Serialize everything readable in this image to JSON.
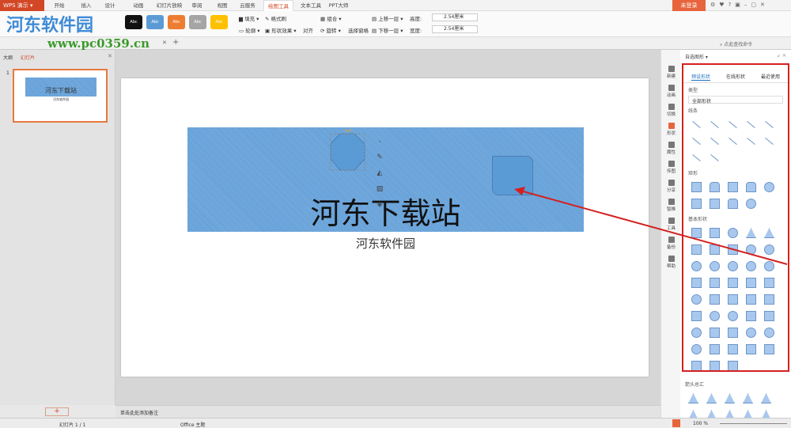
{
  "app": {
    "menu_label": "WPS 演示",
    "login_label": "未登录"
  },
  "tabs": [
    "开始",
    "插入",
    "设计",
    "动画",
    "幻灯片放映",
    "审阅",
    "视图",
    "云服务",
    "绘图工具",
    "文本工具",
    "PPT大师"
  ],
  "active_tab": "绘图工具",
  "ribbon": {
    "style_swatches": [
      {
        "label": "Abc",
        "color": "#111111"
      },
      {
        "label": "Abc",
        "color": "#5b9bd5"
      },
      {
        "label": "Abc",
        "color": "#ed7d31"
      },
      {
        "label": "Abc",
        "color": "#a5a5a5"
      },
      {
        "label": "Abc",
        "color": "#ffc000"
      }
    ],
    "fill": "填充",
    "format_painter": "格式刷",
    "outline": "轮廓",
    "shape_effect": "形状效果",
    "align": "对齐",
    "group": "组合",
    "rotate": "旋转",
    "select_pane": "选择窗格",
    "bring_forward": "上移一层",
    "send_backward": "下移一层",
    "height_label": "高度:",
    "height_value": "2.54厘米",
    "width_label": "宽度:",
    "width_value": "2.54厘米",
    "search_placeholder": "点此查找命令"
  },
  "watermark": {
    "brand": "河东软件园",
    "url": "www.pc0359.cn"
  },
  "left_panel": {
    "tab_outline": "大纲",
    "tab_slides": "幻灯片",
    "slide_number": "1",
    "add_label": "+"
  },
  "slide": {
    "title": "河东下载站",
    "subtitle": "河东软件园"
  },
  "notes_placeholder": "单击此处添加备注",
  "sidebar": [
    {
      "label": "新建",
      "icon": "new-icon"
    },
    {
      "label": "动画",
      "icon": "animation-icon"
    },
    {
      "label": "切换",
      "icon": "transition-icon"
    },
    {
      "label": "形状",
      "icon": "shape-icon"
    },
    {
      "label": "属性",
      "icon": "property-icon"
    },
    {
      "label": "传图",
      "icon": "upload-image-icon"
    },
    {
      "label": "分享",
      "icon": "share-icon"
    },
    {
      "label": "智推",
      "icon": "smart-icon"
    },
    {
      "label": "工具",
      "icon": "tools-icon"
    },
    {
      "label": "备份",
      "icon": "backup-icon"
    },
    {
      "label": "帮助",
      "icon": "help-icon"
    }
  ],
  "pane": {
    "title": "自选图形",
    "tabs": [
      "预设形状",
      "在线形状",
      "最近使用"
    ],
    "type_label": "类型",
    "type_value": "全部形状",
    "sections": [
      {
        "name": "线条",
        "shapes": [
          "line",
          "arrow",
          "double-arrow",
          "elbow",
          "elbow-arrow",
          "elbow-double-arrow",
          "curve",
          "curve-arrow",
          "curve-double-arrow",
          "s-curve",
          "freeform",
          "scribble"
        ]
      },
      {
        "name": "矩形",
        "shapes": [
          "rectangle",
          "rounded-rectangle",
          "snip-corner",
          "round-corner",
          "snip-diagonal",
          "snip-same",
          "snip-single",
          "round-same",
          "round-diagonal"
        ]
      },
      {
        "name": "基本形状",
        "shapes": [
          "text-box",
          "vertical-text-box",
          "oval",
          "triangle",
          "right-triangle",
          "parallelogram",
          "trapezoid",
          "diamond",
          "pentagon",
          "hexagon",
          "heptagon-7",
          "octagon-8",
          "decagon-10",
          "dodecagon-12",
          "pie",
          "chord",
          "teardrop",
          "frame",
          "half-frame",
          "l-shape",
          "diagonal-stripe",
          "cross",
          "plus",
          "can",
          "cube",
          "bevel",
          "donut",
          "no-symbol",
          "arc",
          "folded-corner",
          "smiley",
          "heart",
          "lightning",
          "sun",
          "moon",
          "cloud",
          "arc2",
          "bracket-pair",
          "brace-pair",
          "left-bracket",
          "right-bracket",
          "left-brace",
          "right-brace"
        ]
      },
      {
        "name": "箭头总汇",
        "shapes": [
          "right-arrow",
          "left-arrow",
          "up-arrow",
          "down-arrow",
          "left-right-arrow",
          "up-down-arrow",
          "quad-arrow",
          "left-right-up-arrow",
          "bent-arrow",
          "u-turn-arrow"
        ]
      }
    ]
  },
  "status": {
    "slide_count": "幻灯片 1 / 1",
    "theme": "Office 主题",
    "zoom": "100 %"
  }
}
